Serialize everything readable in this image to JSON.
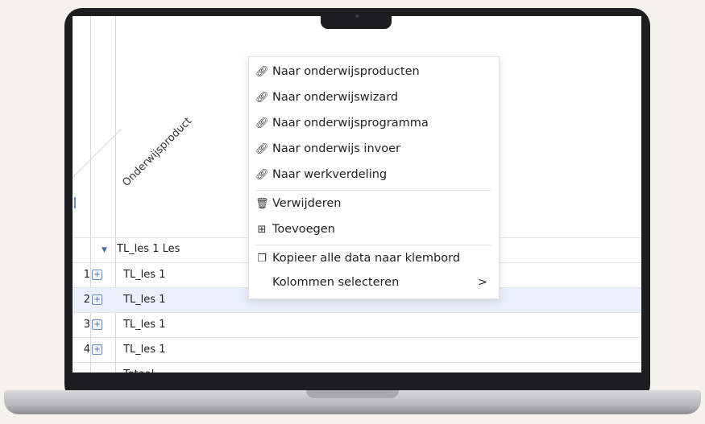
{
  "grid": {
    "column_header": "Onderwijsproduct",
    "group_label": "TL_les 1 Les",
    "rows": [
      {
        "num": "1",
        "text": "TL_les 1"
      },
      {
        "num": "2",
        "text": "TL_les 1"
      },
      {
        "num": "3",
        "text": "TL_les 1"
      },
      {
        "num": "4",
        "text": "TL_les 1"
      }
    ],
    "total_label": "Totaal"
  },
  "context_menu": {
    "items": [
      {
        "label": "Naar onderwijsproducten",
        "icon": "link-icon"
      },
      {
        "label": "Naar onderwijswizard",
        "icon": "link-icon"
      },
      {
        "label": "Naar onderwijsprogramma",
        "icon": "link-icon"
      },
      {
        "label": "Naar onderwijs invoer",
        "icon": "link-icon"
      },
      {
        "label": "Naar werkverdeling",
        "icon": "link-icon"
      },
      {
        "label": "Verwijderen",
        "icon": "trash-icon"
      },
      {
        "label": "Toevoegen",
        "icon": "plus-box-icon"
      },
      {
        "label": "Kopieer alle data naar klembord",
        "icon": "copy-icon"
      },
      {
        "label": "Kolommen selecteren",
        "icon": "chevron-right-icon"
      }
    ],
    "submenu_glyph": ">"
  }
}
